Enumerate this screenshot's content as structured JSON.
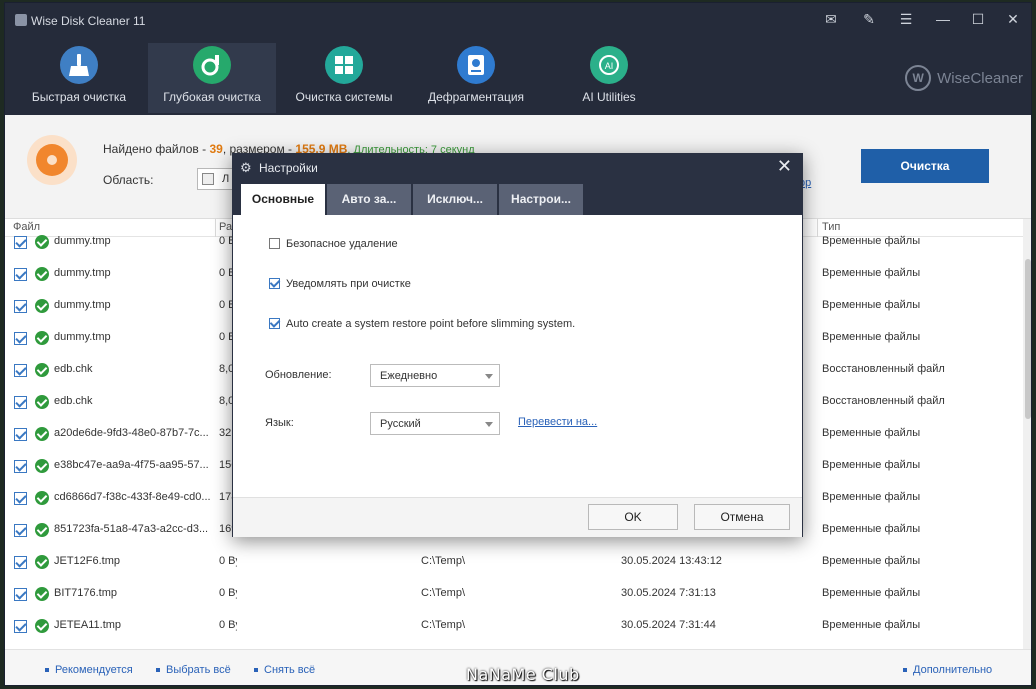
{
  "window": {
    "title": "Wise Disk Cleaner 11"
  },
  "window_controls": [
    {
      "name": "feedback-icon",
      "glyph": "✉"
    },
    {
      "name": "notes-icon",
      "glyph": "✎"
    },
    {
      "name": "menu-icon",
      "glyph": "☰"
    },
    {
      "name": "minimize-icon",
      "glyph": "—"
    },
    {
      "name": "maximize-icon",
      "glyph": "☐"
    },
    {
      "name": "close-icon",
      "glyph": "✕"
    }
  ],
  "nav": {
    "tabs": [
      {
        "label": "Быстрая очистка",
        "icon": "broom-icon",
        "color": "#3f7fc4",
        "active": false
      },
      {
        "label": "Глубокая очистка",
        "icon": "deep-clean-icon",
        "color": "#26a96c",
        "active": true
      },
      {
        "label": "Очистка системы",
        "icon": "windows-icon",
        "color": "#23a89a",
        "active": false
      },
      {
        "label": "Дефрагментация",
        "icon": "defrag-icon",
        "color": "#2f7bd0",
        "active": false
      },
      {
        "label": "AI Utilities",
        "icon": "ai-icon",
        "color": "#2bb08a",
        "active": false
      }
    ],
    "brand": "WiseCleaner",
    "brand_logo": "W"
  },
  "summary": {
    "found_prefix": "Найдено файлов - ",
    "found_count": "39",
    "size_prefix": ", размером - ",
    "size_value": "155,9 MB",
    "duration": ". Длительность: 7 секунд",
    "area_label": "Область:",
    "area_value": "Л",
    "tail_link": "ор",
    "clean_button": "Очистка"
  },
  "table": {
    "headers": {
      "file": "Файл",
      "size": "Раз",
      "type": "Тип"
    },
    "rows": [
      {
        "name": "dummy.tmp",
        "size": "0 B",
        "path": "",
        "date": "",
        "type": "Временные файлы"
      },
      {
        "name": "dummy.tmp",
        "size": "0 B",
        "path": "",
        "date": "",
        "type": "Временные файлы"
      },
      {
        "name": "dummy.tmp",
        "size": "0 B",
        "path": "",
        "date": "",
        "type": "Временные файлы"
      },
      {
        "name": "dummy.tmp",
        "size": "0 B",
        "path": "",
        "date": "",
        "type": "Временные файлы"
      },
      {
        "name": "edb.chk",
        "size": "8,0",
        "path": "",
        "date": "",
        "type": "Восстановленный файл"
      },
      {
        "name": "edb.chk",
        "size": "8,0",
        "path": "",
        "date": "",
        "type": "Восстановленный файл"
      },
      {
        "name": "a20de6de-9fd3-48e0-87b7-7c...",
        "size": "32!",
        "path": "",
        "date": "",
        "type": "Временные файлы"
      },
      {
        "name": "e38bc47e-aa9a-4f75-aa95-57...",
        "size": "156",
        "path": "",
        "date": "",
        "type": "Временные файлы"
      },
      {
        "name": "cd6866d7-f38c-433f-8e49-cd0...",
        "size": "178",
        "path": "",
        "date": "",
        "type": "Временные файлы"
      },
      {
        "name": "851723fa-51a8-47a3-a2cc-d3...",
        "size": "169",
        "path": "",
        "date": "",
        "type": "Временные файлы"
      },
      {
        "name": "JET12F6.tmp",
        "size": "0 Bytes",
        "path": "C:\\Temp\\",
        "date": "30.05.2024 13:43:12",
        "type": "Временные файлы"
      },
      {
        "name": "BIT7176.tmp",
        "size": "0 Bytes",
        "path": "C:\\Temp\\",
        "date": "30.05.2024 7:31:13",
        "type": "Временные файлы"
      },
      {
        "name": "JETEA11.tmp",
        "size": "0 Bytes",
        "path": "C:\\Temp\\",
        "date": "30.05.2024 7:31:44",
        "type": "Временные файлы"
      }
    ]
  },
  "footer": {
    "recommended": "Рекомендуется",
    "select_all": "Выбрать всё",
    "deselect_all": "Снять всё",
    "more": "Дополнительно"
  },
  "watermark": "NaNaMe Club",
  "dialog": {
    "title": "Настройки",
    "tabs": [
      "Основные",
      "Авто за...",
      "Исключ...",
      "Настрои..."
    ],
    "active_tab": 0,
    "options": [
      {
        "label": "Безопасное удаление",
        "checked": false
      },
      {
        "label": "Уведомлять при очистке",
        "checked": true
      },
      {
        "label": "Auto create a system restore point before slimming system.",
        "checked": true
      }
    ],
    "update_label": "Обновление:",
    "update_value": "Ежедневно",
    "language_label": "Язык:",
    "language_value": "Русский",
    "translate_link": "Перевести на...",
    "ok": "OK",
    "cancel": "Отмена"
  }
}
